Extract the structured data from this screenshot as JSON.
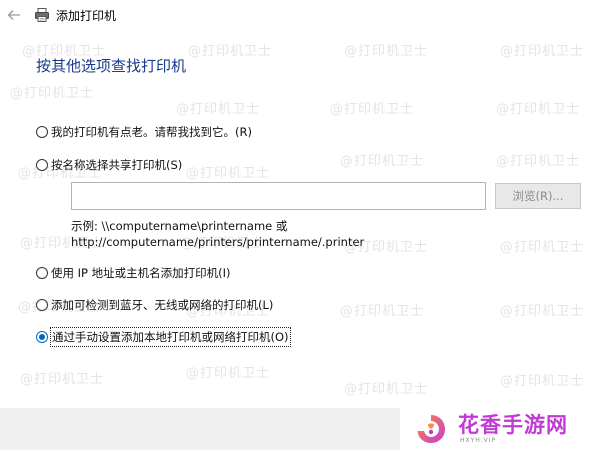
{
  "window": {
    "title": "添加打印机"
  },
  "page": {
    "heading": "按其他选项查找打印机"
  },
  "options": [
    {
      "label": "我的打印机有点老。请帮我找到它。(R)",
      "selected": false
    },
    {
      "label": "按名称选择共享打印机(S)",
      "selected": false
    },
    {
      "label": "使用 IP 地址或主机名添加打印机(I)",
      "selected": false
    },
    {
      "label": "添加可检测到蓝牙、无线或网络的打印机(L)",
      "selected": false
    },
    {
      "label": "通过手动设置添加本地打印机或网络打印机(O)",
      "selected": true
    }
  ],
  "share_input": {
    "value": "",
    "placeholder": ""
  },
  "browse_button": {
    "label": "浏览(R)..."
  },
  "example": {
    "line1": "示例: \\\\computername\\printername 或",
    "line2": "http://computername/printers/printername/.printer"
  },
  "watermark": {
    "text": "@打印机卫士"
  },
  "brand": {
    "name": "花香手游网",
    "url": "HXYH.VIP"
  },
  "colors": {
    "heading": "#1b3a8a",
    "accent": "#0067c0",
    "bottom_bar": "#f0f0f0"
  },
  "icons": {
    "back": "back-arrow-icon",
    "printer": "printer-icon"
  }
}
